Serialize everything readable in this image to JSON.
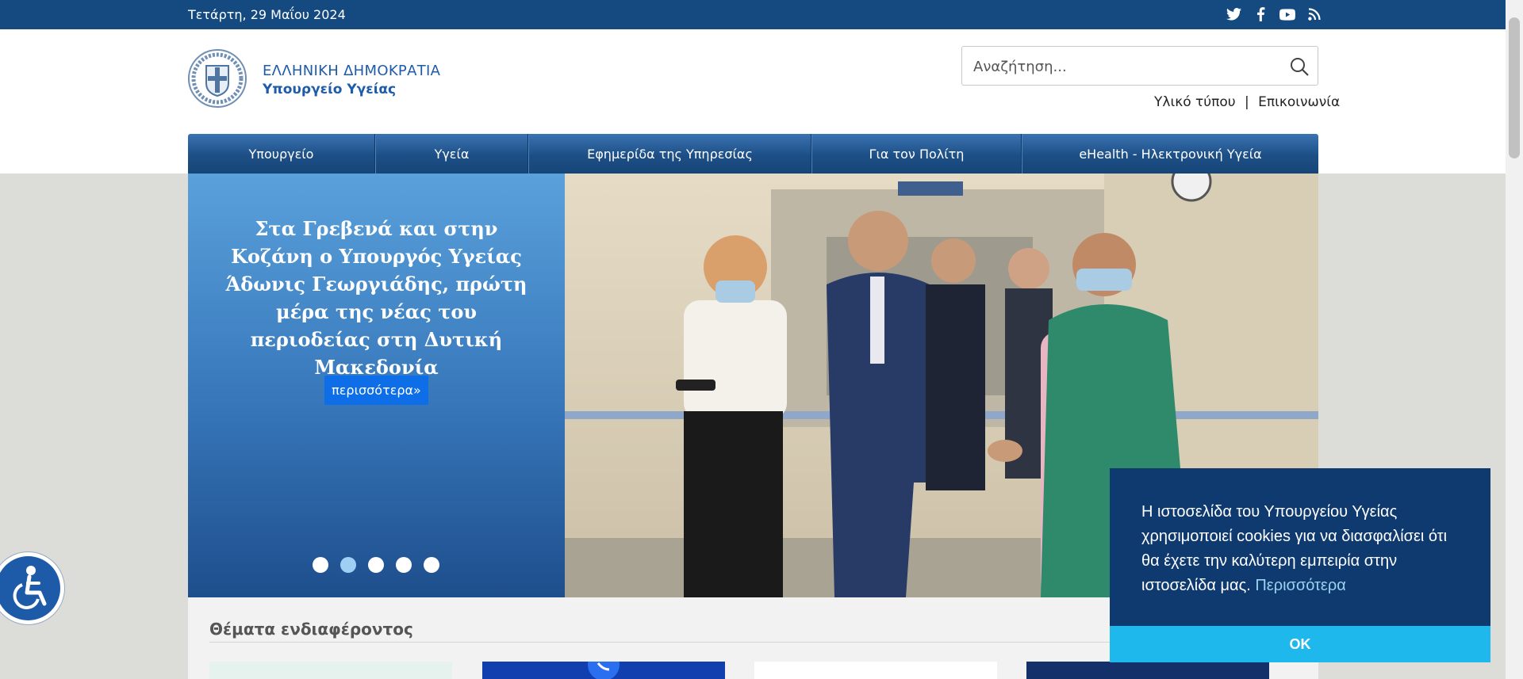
{
  "topbar": {
    "date": "Τετάρτη, 29 Μαΐου 2024",
    "social_icons": [
      "twitter-icon",
      "facebook-icon",
      "youtube-icon",
      "rss-icon"
    ]
  },
  "header": {
    "logo_line1": "ΕΛΛΗΝΙΚΗ ΔΗΜΟΚΡΑΤΙΑ",
    "logo_line2": "Υπουργείο Υγείας",
    "search_placeholder": "Αναζήτηση...",
    "links": [
      "Υλικό τύπου",
      "Επικοινωνία"
    ],
    "link_separator": "|"
  },
  "nav": {
    "items": [
      "Υπουργείο",
      "Υγεία",
      "Εφημερίδα της Υπηρεσίας",
      "Για τον Πολίτη",
      "eHealth - Ηλεκτρονική Υγεία"
    ]
  },
  "slider": {
    "title": "Στα Γρεβενά και στην Κοζάνη ο Υπουργός Υγείας Άδωνις Γεωργιάδης, πρώτη μέρα της νέας του περιοδείας στη Δυτική Μακεδονία",
    "more_label": "περισσότερα»",
    "dot_count": 5,
    "active_dot": 2
  },
  "topics": {
    "title": "Θέματα ενδιαφέροντος"
  },
  "cookie": {
    "text": "Η ιστοσελίδα του Υπουργείου Υγείας χρησιμοποιεί cookies για να διασφαλίσει ότι θα έχετε την καλύτερη εμπειρία στην ιστοσελίδα μας.",
    "link": "Περισσότερα",
    "ok": "OK"
  },
  "colors": {
    "brand_blue": "#144a80",
    "accent_button": "#0d6ee8",
    "cookie_bg": "#0f3a70",
    "cookie_ok": "#1fb8ec"
  }
}
